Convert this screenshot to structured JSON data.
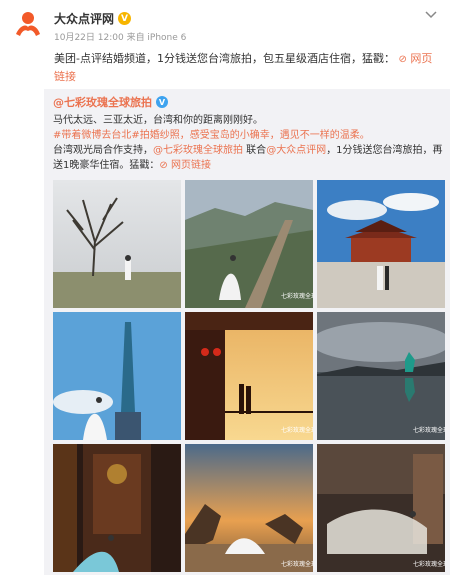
{
  "header": {
    "name": "大众点评网",
    "verified_mark": "V",
    "meta": "10月22日 12:00 来自 iPhone 6"
  },
  "post": {
    "text": "美团-点评结婚频道，1分钱送您台湾旅拍，包五星级酒店住宿，猛戳：",
    "link_icon": "⊘",
    "link_label": "网页链接"
  },
  "repost": {
    "author": "@七彩玫瑰全球旅拍",
    "verified_mark": "V",
    "line1": "马代太远、三亚太近，台湾和你的距离刚刚好。",
    "line2": "#带着微博去台北#拍婚纱照，感受宝岛的小确幸，遇见不一样的温柔。",
    "line3_a": "台湾观光局合作支持，",
    "line3_link1": "@七彩玫瑰全球旅拍",
    "line3_b": " 联合",
    "line3_link2": "@大众点评网",
    "line3_c": "，1分钱送您台湾旅拍，再送1晚豪华住宿。猛戳：",
    "link_icon": "⊘",
    "link_label": "网页链接"
  },
  "watermark": "七彩玫瑰全球",
  "colors": {
    "accent": "#eb7350",
    "repost_bg": "#f2f2f5",
    "verified_gold": "#f7b500",
    "verified_blue": "#3ea3ef"
  },
  "photos": [
    {
      "name": "photo-tree-field"
    },
    {
      "name": "photo-mountain-trail"
    },
    {
      "name": "photo-temple"
    },
    {
      "name": "photo-taipei-101"
    },
    {
      "name": "photo-balcony-sunset"
    },
    {
      "name": "photo-lake-reflection"
    },
    {
      "name": "photo-temple-door"
    },
    {
      "name": "photo-rocks-sunset"
    },
    {
      "name": "photo-interior-veil"
    }
  ]
}
